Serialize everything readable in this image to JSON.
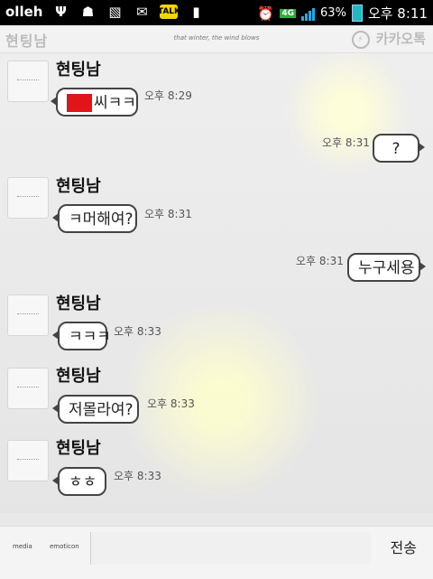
{
  "statusbar": {
    "carrier": "olleh",
    "network": "4G",
    "battery": "63%",
    "clock": "오후 8:11",
    "signal_level": 4,
    "kakao_badge": "TALK",
    "icons": [
      "usb-icon",
      "android-icon",
      "image-icon",
      "mail-icon",
      "kakaotalk-icon",
      "sim-icon",
      "alarm-icon"
    ]
  },
  "header": {
    "title": "현팅남",
    "tagline": "that winter, the wind blows",
    "brand": "카카오톡"
  },
  "messages": [
    {
      "side": "left",
      "sender": "현팅남",
      "text": "씨ㅋㅋ",
      "time": "오후 8:29",
      "redacted": true
    },
    {
      "side": "right",
      "text": "?",
      "time": "오후 8:31"
    },
    {
      "side": "left",
      "sender": "현팅남",
      "text": "ㅋ머해여?",
      "time": "오후 8:31"
    },
    {
      "side": "right",
      "text": "누구세용",
      "time": "오후 8:31"
    },
    {
      "side": "left",
      "sender": "현팅남",
      "text": "ㅋㅋㅋ",
      "time": "오후 8:33"
    },
    {
      "side": "left",
      "sender": "현팅남",
      "text": "저몰라여?",
      "time": "오후 8:33"
    },
    {
      "side": "left",
      "sender": "현팅남",
      "text": "ㅎㅎ",
      "time": "오후 8:33"
    }
  ],
  "inputbar": {
    "media_label": "media",
    "emoticon_label": "emoticon",
    "input_value": "",
    "send_label": "전송"
  }
}
